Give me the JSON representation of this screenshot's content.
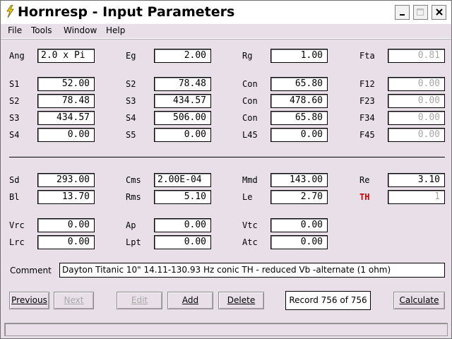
{
  "window": {
    "title": "Hornresp - Input Parameters"
  },
  "menu": {
    "file": "File",
    "tools": "Tools",
    "window": "Window",
    "help": "Help"
  },
  "labels": {
    "ang": "Ang",
    "eg": "Eg",
    "rg": "Rg",
    "fta": "Fta",
    "s1": "S1",
    "s2a": "S2",
    "con1": "Con",
    "f12": "F12",
    "s2": "S2",
    "s3a": "S3",
    "con2": "Con",
    "f23": "F23",
    "s3": "S3",
    "s4a": "S4",
    "con3": "Con",
    "f34": "F34",
    "s4": "S4",
    "s5": "S5",
    "l45": "L45",
    "f45": "F45",
    "sd": "Sd",
    "cms": "Cms",
    "mmd": "Mmd",
    "re": "Re",
    "bl": "Bl",
    "rms": "Rms",
    "le": "Le",
    "th": "TH",
    "vrc": "Vrc",
    "ap": "Ap",
    "vtc": "Vtc",
    "lrc": "Lrc",
    "lpt": "Lpt",
    "atc": "Atc",
    "comment": "Comment"
  },
  "values": {
    "ang": "2.0 x Pi",
    "eg": "2.00",
    "rg": "1.00",
    "fta": "0.81",
    "s1": "52.00",
    "s2a": "78.48",
    "con1": "65.80",
    "f12": "0.00",
    "s2": "78.48",
    "s3a": "434.57",
    "con2": "478.60",
    "f23": "0.00",
    "s3": "434.57",
    "s4a": "506.00",
    "con3": "65.80",
    "f34": "0.00",
    "s4": "0.00",
    "s5": "0.00",
    "l45": "0.00",
    "f45": "0.00",
    "sd": "293.00",
    "cms": "2.00E-04",
    "mmd": "143.00",
    "re": "3.10",
    "bl": "13.70",
    "rms": "5.10",
    "le": "2.70",
    "th": "1",
    "vrc": "0.00",
    "ap": "0.00",
    "vtc": "0.00",
    "lrc": "0.00",
    "lpt": "0.00",
    "atc": "0.00",
    "comment": "Dayton Titanic 10\" 14.11-130.93 Hz conic TH - reduced Vb -alternate (1 ohm)"
  },
  "buttons": {
    "previous": "Previous",
    "next": "Next",
    "edit": "Edit",
    "add": "Add",
    "delete": "Delete",
    "calculate": "Calculate"
  },
  "record": "Record 756 of 756",
  "icons": {
    "app": "lightning-icon",
    "minimize": "minimize-icon",
    "maximize": "maximize-icon",
    "close": "close-icon"
  },
  "colors": {
    "background": "#e8dfe8",
    "th_label": "#d40000",
    "disabled": "#a8a8a8"
  }
}
